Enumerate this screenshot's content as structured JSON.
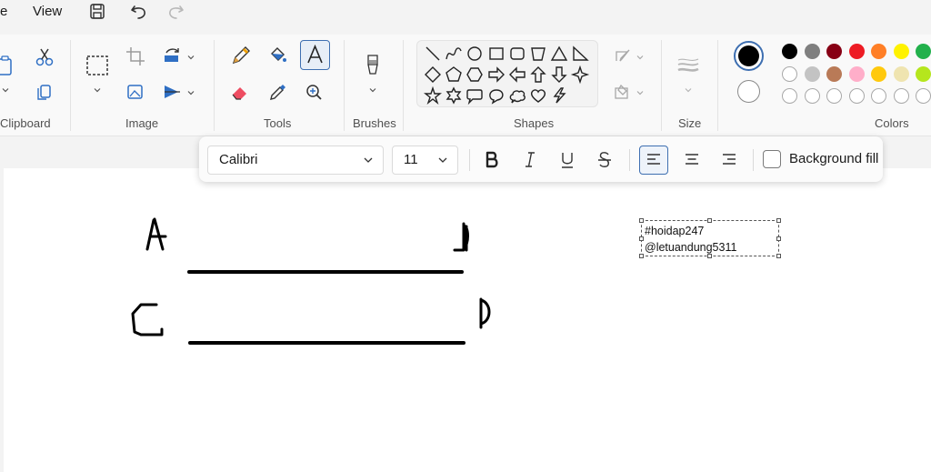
{
  "menu": {
    "file_partial": "e",
    "view": "View"
  },
  "ribbon": {
    "groups": {
      "clipboard": "Clipboard",
      "image": "Image",
      "tools": "Tools",
      "brushes": "Brushes",
      "shapes": "Shapes",
      "size": "Size",
      "colors": "Colors"
    },
    "shapes": [
      "line",
      "curve",
      "oval",
      "rectangle",
      "rounded-rectangle",
      "polygon",
      "triangle",
      "right-triangle",
      "diamond",
      "pentagon",
      "hexagon",
      "right-arrow",
      "left-arrow",
      "up-arrow",
      "down-arrow",
      "four-point-star",
      "five-point-star",
      "six-point-star",
      "rounded-callout",
      "oval-callout",
      "cloud-callout",
      "heart",
      "lightning"
    ],
    "active_tool": "text",
    "primary_color": "#000000",
    "secondary_color": "#ffffff",
    "palette": [
      [
        "#000000",
        "#7f7f7f",
        "#880015",
        "#ed1c24",
        "#ff7f27",
        "#fff200",
        "#22b14c"
      ],
      [
        "#ffffff",
        "#c3c3c3",
        "#b97a57",
        "#ffaec9",
        "#ffc90e",
        "#efe4b0",
        "#b5e61d"
      ],
      [
        "empty",
        "empty",
        "empty",
        "empty",
        "empty",
        "empty",
        "empty"
      ]
    ]
  },
  "text_toolbar": {
    "font": "Calibri",
    "size": "11",
    "background_fill": "Background fill",
    "alignment": "left"
  },
  "canvas": {
    "textbox_lines": [
      "#hoidap247",
      "@letuandung5311"
    ]
  }
}
